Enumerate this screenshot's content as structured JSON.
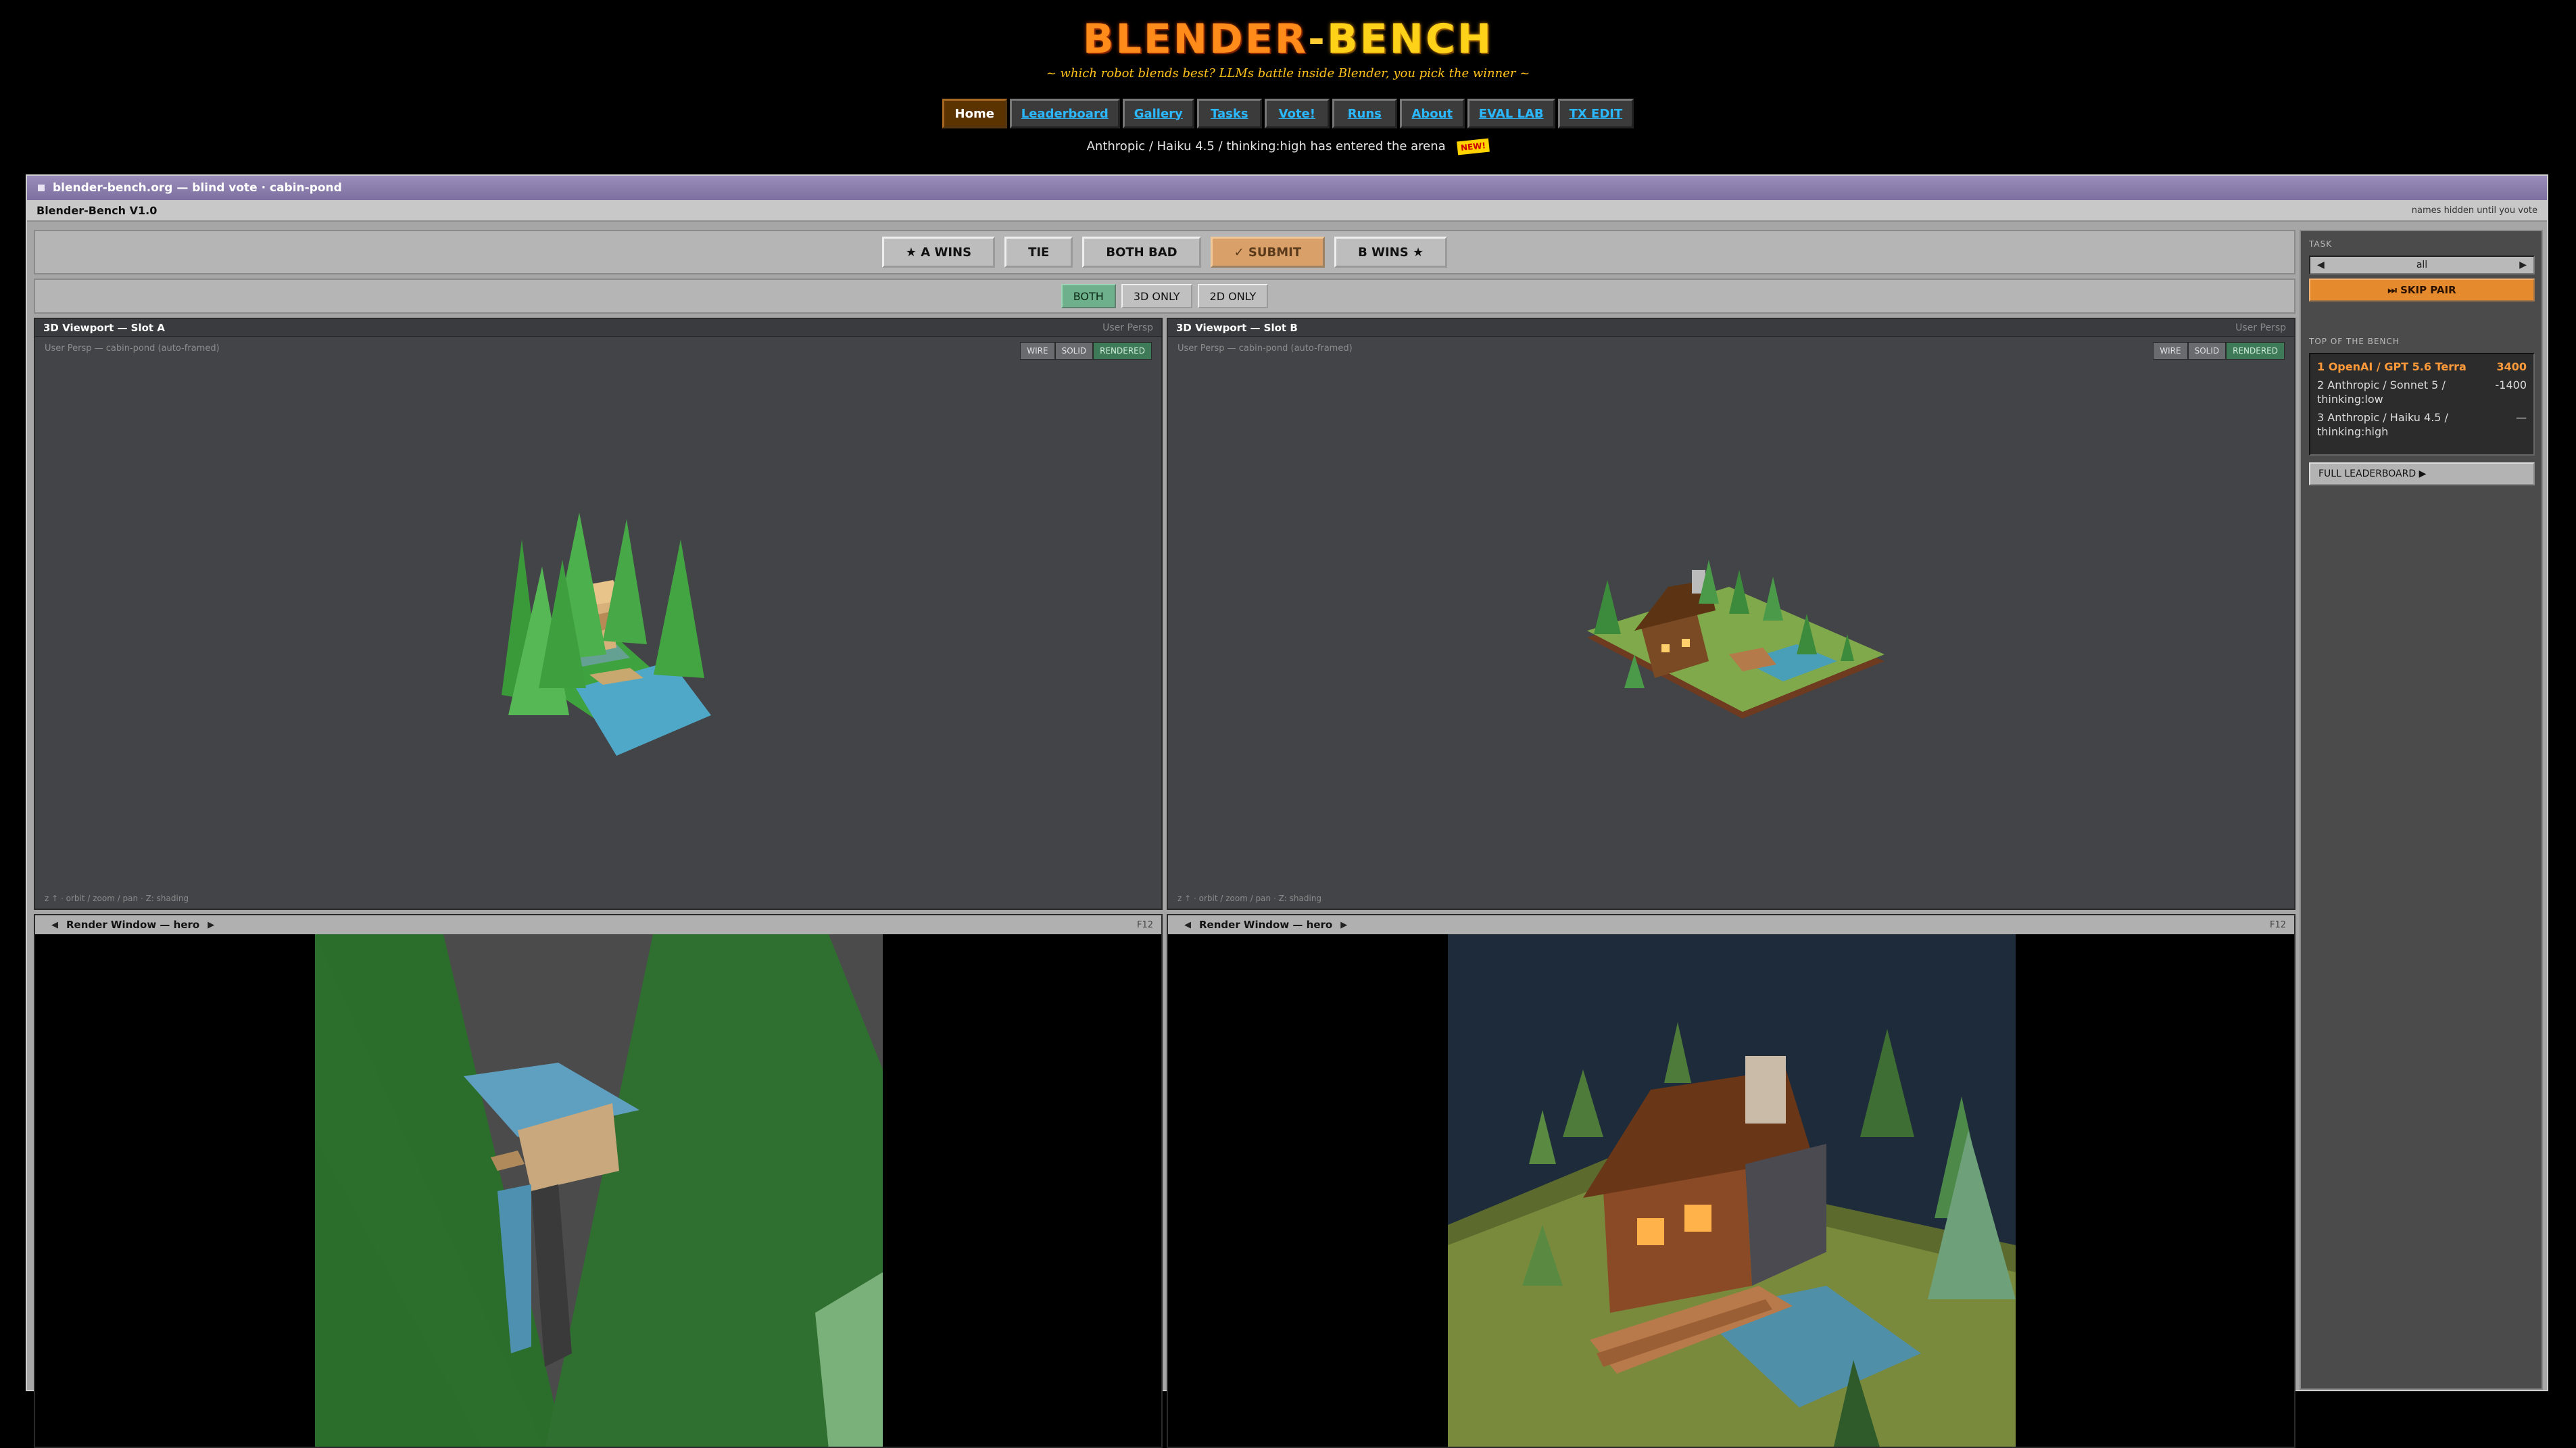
{
  "header": {
    "title_part1": "BLENDER",
    "title_dash": "-",
    "title_part2": "BENCH",
    "tagline": "~ which robot blends best? LLMs battle inside Blender, you pick the winner ~",
    "announcement": "Anthropic / Haiku 4.5 / thinking:high has entered the arena",
    "new_badge": "NEW!"
  },
  "nav": [
    {
      "label": "Home",
      "active": true
    },
    {
      "label": "Leaderboard"
    },
    {
      "label": "Gallery"
    },
    {
      "label": "Tasks"
    },
    {
      "label": "Vote!"
    },
    {
      "label": "Runs"
    },
    {
      "label": "About"
    },
    {
      "label": "EVAL LAB"
    },
    {
      "label": "TX EDIT"
    }
  ],
  "window": {
    "title": "blender-bench.org — blind vote · cabin-pond",
    "app_name": "Blender-Bench V1.0",
    "hidden_note": "names hidden until you vote"
  },
  "vote": {
    "a_wins": "★ A WINS",
    "tie": "TIE",
    "both_bad": "BOTH BAD",
    "submit": "✓ SUBMIT",
    "b_wins": "B WINS ★"
  },
  "modes": {
    "both": "BOTH",
    "d3": "3D ONLY",
    "d2": "2D ONLY"
  },
  "viewport_a": {
    "title": "3D Viewport — Slot A",
    "view": "User Persp",
    "subtitle": "User Persp — cabin-pond (auto-framed)",
    "hint": "z ↑ · orbit / zoom / pan · Z: shading"
  },
  "viewport_b": {
    "title": "3D Viewport — Slot B",
    "view": "User Persp",
    "subtitle": "User Persp — cabin-pond (auto-framed)",
    "hint": "z ↑ · orbit / zoom / pan · Z: shading"
  },
  "shading": {
    "wire": "WIRE",
    "solid": "SOLID",
    "rendered": "RENDERED"
  },
  "render_a": {
    "title": "Render Window — hero",
    "key": "F12"
  },
  "render_b": {
    "title": "Render Window — hero",
    "key": "F12"
  },
  "sidebar": {
    "task_label": "TASK",
    "task_value": "all",
    "skip": "⏭ SKIP PAIR",
    "bench_label": "TOP OF THE BENCH",
    "bench": [
      {
        "name": "1 OpenAI / GPT 5.6 Terra",
        "score": "3400"
      },
      {
        "name": "2 Anthropic / Sonnet 5 / thinking:low",
        "score": "-1400"
      },
      {
        "name": "3 Anthropic / Haiku 4.5 / thinking:high",
        "score": "—"
      }
    ],
    "full_leaderboard": "FULL LEADERBOARD ▶"
  },
  "colors": {
    "title_orange": "#ff8c1a",
    "title_yellow": "#ffd21a",
    "nav_link": "#2bb8ff",
    "submit_bg": "#d9a06a",
    "skip_bg": "#e68a2e",
    "viewport_bg": "#434447",
    "rendered_active": "#3f7a58"
  }
}
